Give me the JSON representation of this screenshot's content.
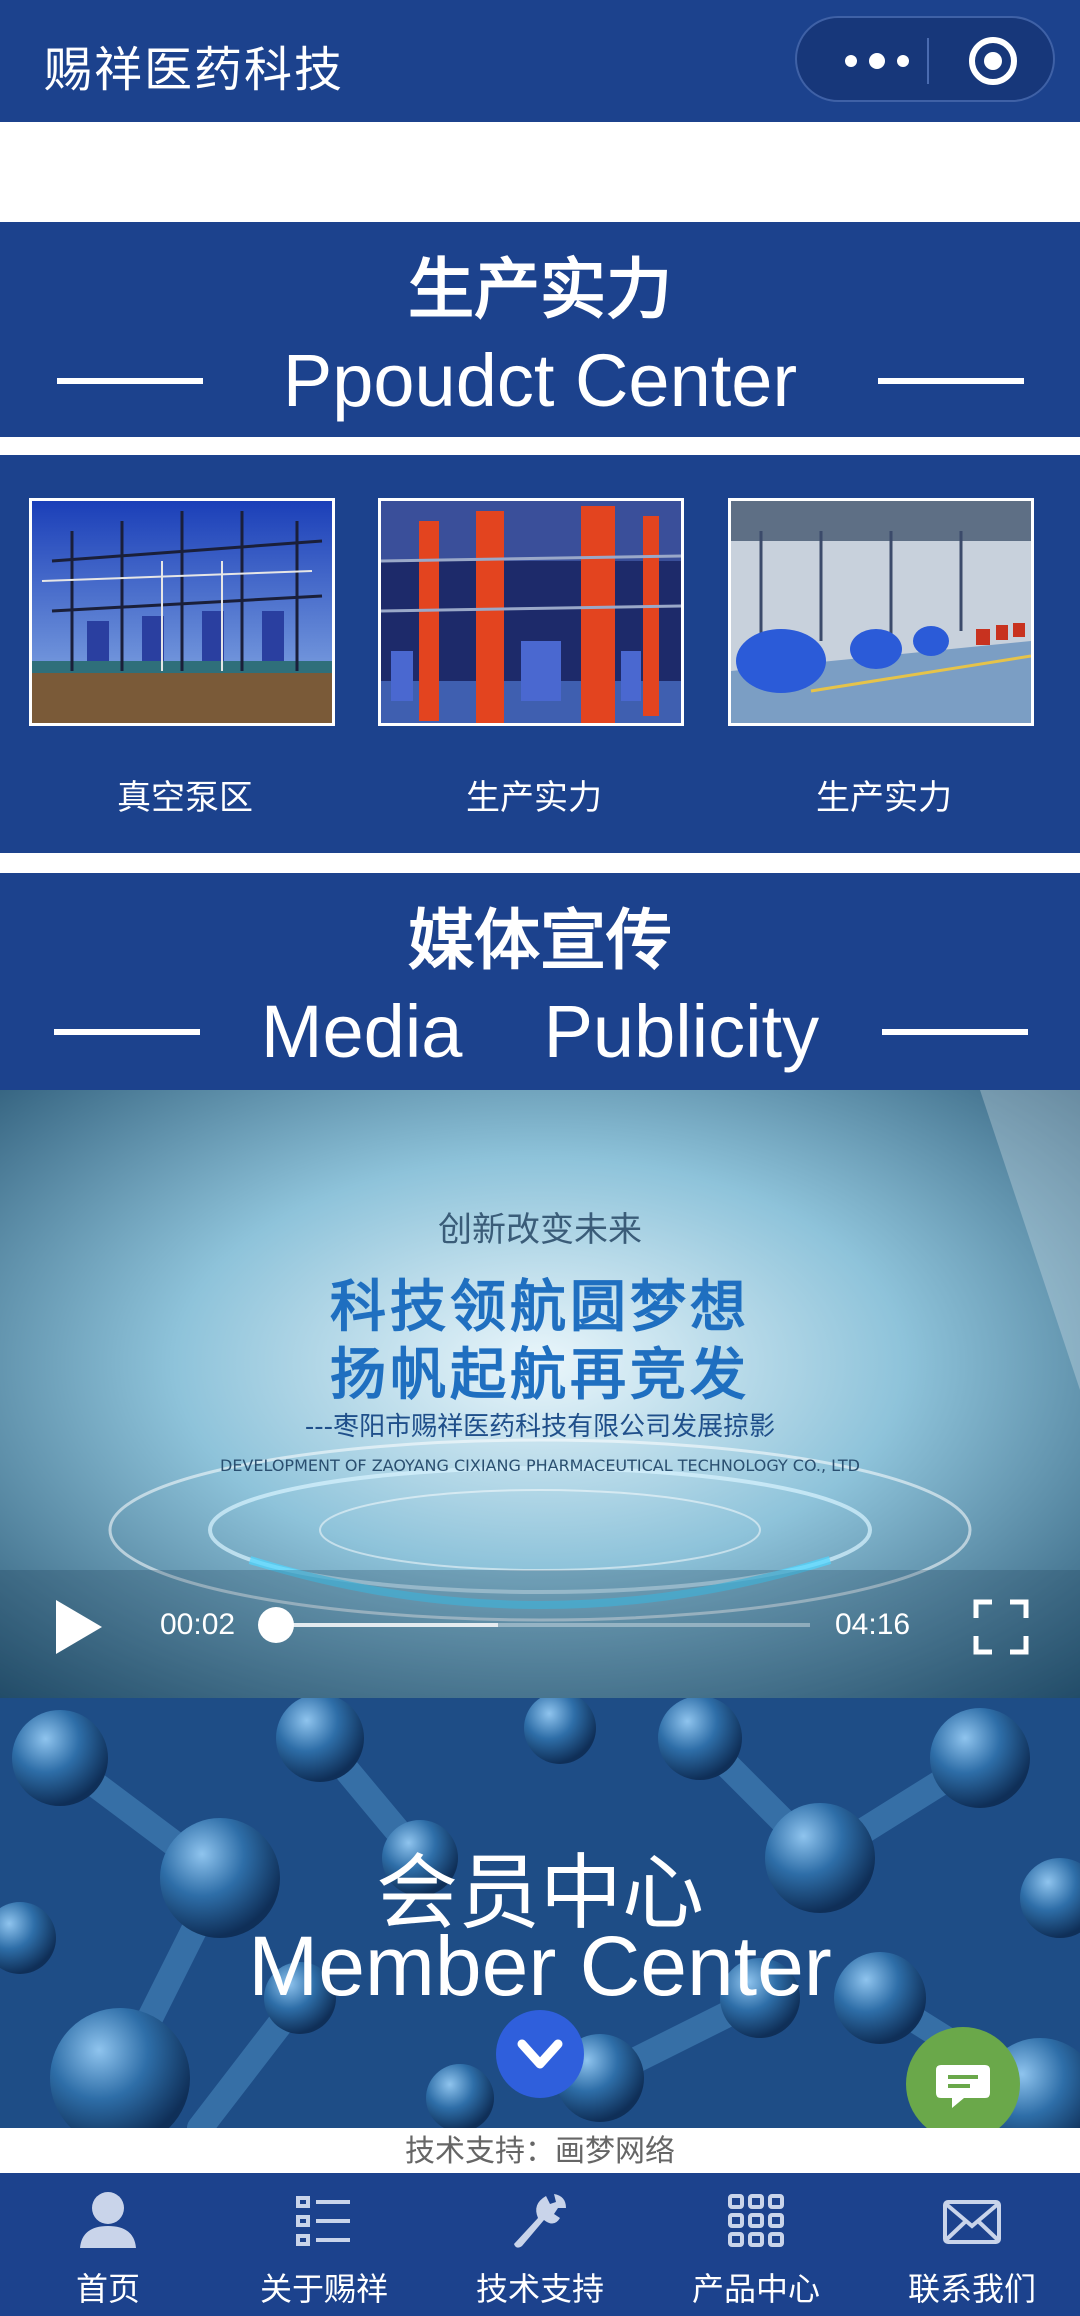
{
  "app": {
    "title": "赐祥医药科技"
  },
  "capsule": {
    "more_icon": "more-dots-icon",
    "close_icon": "target-circle-icon"
  },
  "production": {
    "title_cn": "生产实力",
    "title_en": "Ppoudct Center",
    "items": [
      {
        "caption": "真空泵区"
      },
      {
        "caption": "生产实力"
      },
      {
        "caption": "生产实力"
      }
    ]
  },
  "media": {
    "title_cn": "媒体宣传",
    "title_en_1": "Media",
    "title_en_2": "Publicity",
    "video": {
      "line1": "创新改变未来",
      "line2": "科技领航圆梦想",
      "line3": "扬帆起航再竞发",
      "line4": "---枣阳市赐祥医药科技有限公司发展掠影",
      "line5": "DEVELOPMENT OF ZAOYANG CIXIANG PHARMACEUTICAL TECHNOLOGY CO., LTD",
      "current_time": "00:02",
      "duration": "04:16",
      "progress": 0.008,
      "buffered": 0.42
    }
  },
  "member": {
    "title_cn": "会员中心",
    "title_en": "Member Center"
  },
  "footer": {
    "note": "技术支持：画梦网络"
  },
  "nav": [
    {
      "label": "首页",
      "icon": "user-icon"
    },
    {
      "label": "关于赐祥",
      "icon": "list-icon"
    },
    {
      "label": "技术支持",
      "icon": "wrench-icon"
    },
    {
      "label": "产品中心",
      "icon": "grid-icon"
    },
    {
      "label": "联系我们",
      "icon": "mail-icon"
    }
  ],
  "colors": {
    "brand_blue": "#1c428d",
    "chat_green": "#6aa84a",
    "scroll_button": "#2f5fdc"
  }
}
